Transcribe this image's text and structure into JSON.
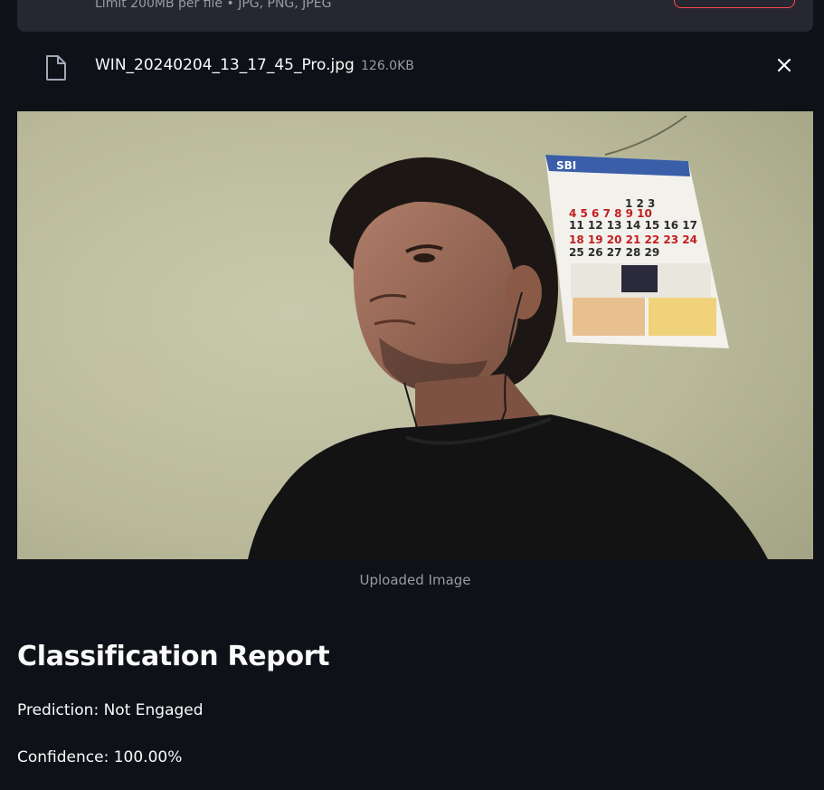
{
  "uploader": {
    "limit_text": "Limit 200MB per file • JPG, PNG, JPEG"
  },
  "file": {
    "name": "WIN_20240204_13_17_45_Pro.jpg",
    "size": "126.0KB"
  },
  "image": {
    "caption": "Uploaded Image"
  },
  "report": {
    "title": "Classification Report",
    "prediction": "Prediction: Not Engaged",
    "confidence": "Confidence: 100.00%"
  },
  "colors": {
    "background": "#0e1117",
    "surface": "#262730",
    "accent": "#ff4b4b",
    "text": "#fafafa",
    "muted_text": "#9a9ba3"
  }
}
